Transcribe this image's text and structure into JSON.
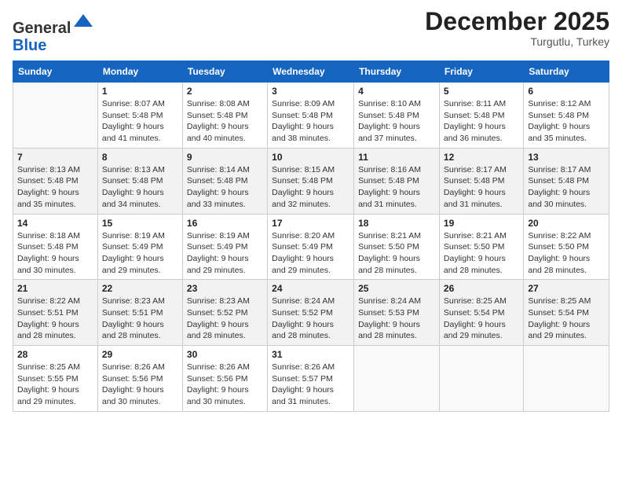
{
  "logo": {
    "general": "General",
    "blue": "Blue"
  },
  "header": {
    "month": "December 2025",
    "location": "Turgutlu, Turkey"
  },
  "days_of_week": [
    "Sunday",
    "Monday",
    "Tuesday",
    "Wednesday",
    "Thursday",
    "Friday",
    "Saturday"
  ],
  "weeks": [
    [
      {
        "day": "",
        "info": ""
      },
      {
        "day": "1",
        "info": "Sunrise: 8:07 AM\nSunset: 5:48 PM\nDaylight: 9 hours\nand 41 minutes."
      },
      {
        "day": "2",
        "info": "Sunrise: 8:08 AM\nSunset: 5:48 PM\nDaylight: 9 hours\nand 40 minutes."
      },
      {
        "day": "3",
        "info": "Sunrise: 8:09 AM\nSunset: 5:48 PM\nDaylight: 9 hours\nand 38 minutes."
      },
      {
        "day": "4",
        "info": "Sunrise: 8:10 AM\nSunset: 5:48 PM\nDaylight: 9 hours\nand 37 minutes."
      },
      {
        "day": "5",
        "info": "Sunrise: 8:11 AM\nSunset: 5:48 PM\nDaylight: 9 hours\nand 36 minutes."
      },
      {
        "day": "6",
        "info": "Sunrise: 8:12 AM\nSunset: 5:48 PM\nDaylight: 9 hours\nand 35 minutes."
      }
    ],
    [
      {
        "day": "7",
        "info": "Sunrise: 8:13 AM\nSunset: 5:48 PM\nDaylight: 9 hours\nand 35 minutes."
      },
      {
        "day": "8",
        "info": "Sunrise: 8:13 AM\nSunset: 5:48 PM\nDaylight: 9 hours\nand 34 minutes."
      },
      {
        "day": "9",
        "info": "Sunrise: 8:14 AM\nSunset: 5:48 PM\nDaylight: 9 hours\nand 33 minutes."
      },
      {
        "day": "10",
        "info": "Sunrise: 8:15 AM\nSunset: 5:48 PM\nDaylight: 9 hours\nand 32 minutes."
      },
      {
        "day": "11",
        "info": "Sunrise: 8:16 AM\nSunset: 5:48 PM\nDaylight: 9 hours\nand 31 minutes."
      },
      {
        "day": "12",
        "info": "Sunrise: 8:17 AM\nSunset: 5:48 PM\nDaylight: 9 hours\nand 31 minutes."
      },
      {
        "day": "13",
        "info": "Sunrise: 8:17 AM\nSunset: 5:48 PM\nDaylight: 9 hours\nand 30 minutes."
      }
    ],
    [
      {
        "day": "14",
        "info": "Sunrise: 8:18 AM\nSunset: 5:48 PM\nDaylight: 9 hours\nand 30 minutes."
      },
      {
        "day": "15",
        "info": "Sunrise: 8:19 AM\nSunset: 5:49 PM\nDaylight: 9 hours\nand 29 minutes."
      },
      {
        "day": "16",
        "info": "Sunrise: 8:19 AM\nSunset: 5:49 PM\nDaylight: 9 hours\nand 29 minutes."
      },
      {
        "day": "17",
        "info": "Sunrise: 8:20 AM\nSunset: 5:49 PM\nDaylight: 9 hours\nand 29 minutes."
      },
      {
        "day": "18",
        "info": "Sunrise: 8:21 AM\nSunset: 5:50 PM\nDaylight: 9 hours\nand 28 minutes."
      },
      {
        "day": "19",
        "info": "Sunrise: 8:21 AM\nSunset: 5:50 PM\nDaylight: 9 hours\nand 28 minutes."
      },
      {
        "day": "20",
        "info": "Sunrise: 8:22 AM\nSunset: 5:50 PM\nDaylight: 9 hours\nand 28 minutes."
      }
    ],
    [
      {
        "day": "21",
        "info": "Sunrise: 8:22 AM\nSunset: 5:51 PM\nDaylight: 9 hours\nand 28 minutes."
      },
      {
        "day": "22",
        "info": "Sunrise: 8:23 AM\nSunset: 5:51 PM\nDaylight: 9 hours\nand 28 minutes."
      },
      {
        "day": "23",
        "info": "Sunrise: 8:23 AM\nSunset: 5:52 PM\nDaylight: 9 hours\nand 28 minutes."
      },
      {
        "day": "24",
        "info": "Sunrise: 8:24 AM\nSunset: 5:52 PM\nDaylight: 9 hours\nand 28 minutes."
      },
      {
        "day": "25",
        "info": "Sunrise: 8:24 AM\nSunset: 5:53 PM\nDaylight: 9 hours\nand 28 minutes."
      },
      {
        "day": "26",
        "info": "Sunrise: 8:25 AM\nSunset: 5:54 PM\nDaylight: 9 hours\nand 29 minutes."
      },
      {
        "day": "27",
        "info": "Sunrise: 8:25 AM\nSunset: 5:54 PM\nDaylight: 9 hours\nand 29 minutes."
      }
    ],
    [
      {
        "day": "28",
        "info": "Sunrise: 8:25 AM\nSunset: 5:55 PM\nDaylight: 9 hours\nand 29 minutes."
      },
      {
        "day": "29",
        "info": "Sunrise: 8:26 AM\nSunset: 5:56 PM\nDaylight: 9 hours\nand 30 minutes."
      },
      {
        "day": "30",
        "info": "Sunrise: 8:26 AM\nSunset: 5:56 PM\nDaylight: 9 hours\nand 30 minutes."
      },
      {
        "day": "31",
        "info": "Sunrise: 8:26 AM\nSunset: 5:57 PM\nDaylight: 9 hours\nand 31 minutes."
      },
      {
        "day": "",
        "info": ""
      },
      {
        "day": "",
        "info": ""
      },
      {
        "day": "",
        "info": ""
      }
    ]
  ]
}
